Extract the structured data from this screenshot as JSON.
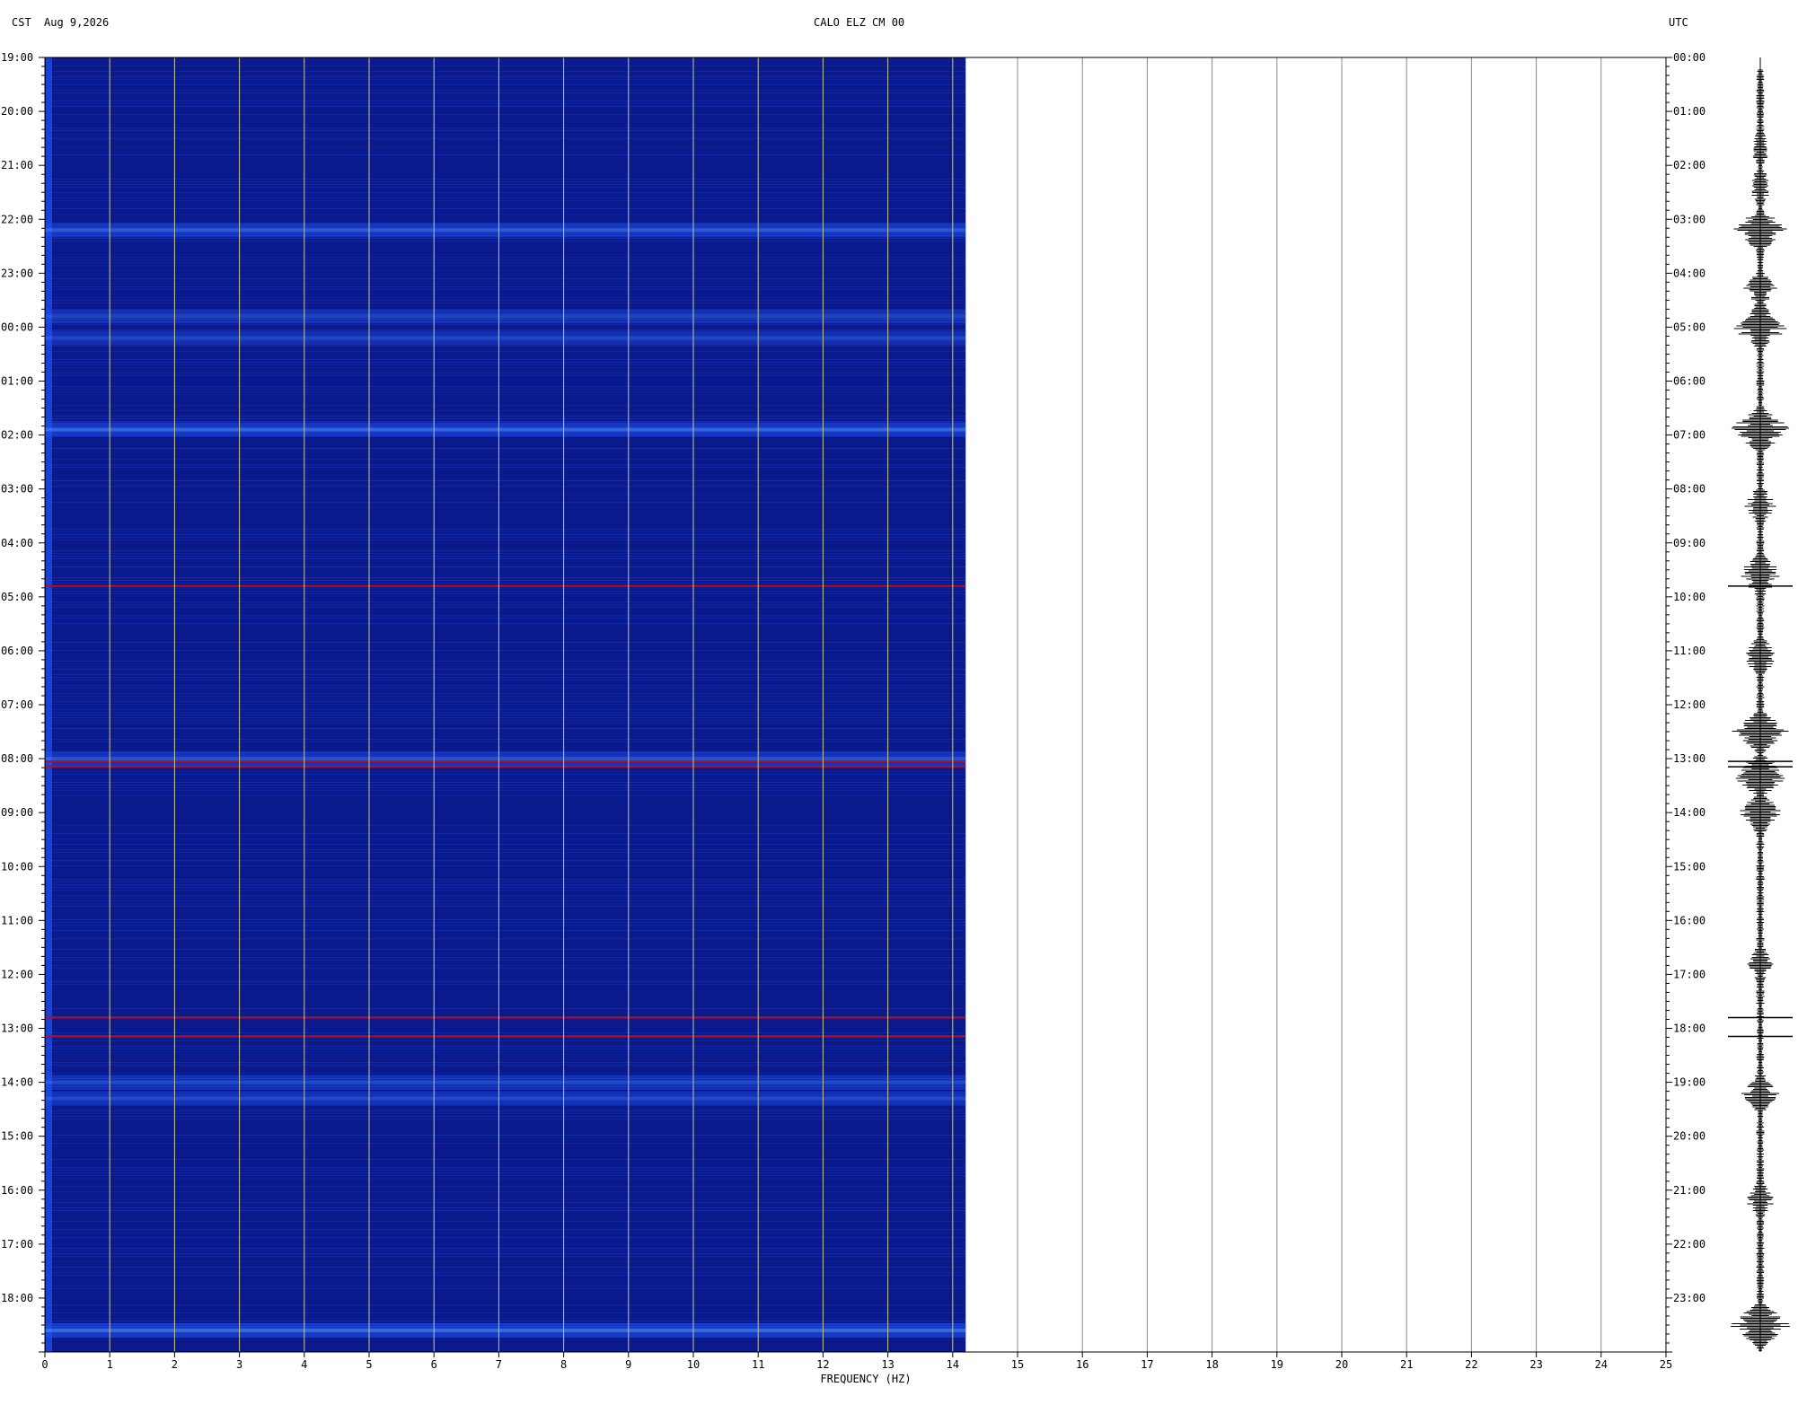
{
  "header": {
    "left_tz": "CST",
    "date": "Aug 9,2026",
    "station": "CALO ELZ CM 00",
    "right_tz": "UTC"
  },
  "chart_data": {
    "type": "heatmap",
    "title": "CALO ELZ CM 00",
    "xlabel": "FREQUENCY (HZ)",
    "x_ticks": [
      "0",
      "1",
      "2",
      "3",
      "4",
      "5",
      "6",
      "7",
      "8",
      "9",
      "10",
      "11",
      "12",
      "13",
      "14",
      "15",
      "16",
      "17",
      "18",
      "19",
      "20",
      "21",
      "22",
      "23",
      "24",
      "25"
    ],
    "xlim": [
      0,
      25
    ],
    "data_xlim": [
      0,
      14.2
    ],
    "left_time_labels": [
      "19:00",
      "20:00",
      "21:00",
      "22:00",
      "23:00",
      "00:00",
      "01:00",
      "02:00",
      "03:00",
      "04:00",
      "05:00",
      "06:00",
      "07:00",
      "08:00",
      "09:00",
      "10:00",
      "11:00",
      "12:00",
      "13:00",
      "14:00",
      "15:00",
      "16:00",
      "17:00",
      "18:00"
    ],
    "right_time_labels": [
      "00:00",
      "01:00",
      "02:00",
      "03:00",
      "04:00",
      "05:00",
      "06:00",
      "07:00",
      "08:00",
      "09:00",
      "10:00",
      "11:00",
      "12:00",
      "13:00",
      "14:00",
      "15:00",
      "16:00",
      "17:00",
      "18:00",
      "19:00",
      "20:00",
      "21:00",
      "22:00",
      "23:00"
    ],
    "time_range_hours": 24,
    "colors": {
      "background": "#0a1a8c",
      "band": "#1f4ef0",
      "strong": "#6fd0ff",
      "spike": "#b01020",
      "grid": "#c8c890"
    },
    "bright_bands_hours": [
      {
        "t": 3.2,
        "level": 0.7
      },
      {
        "t": 4.8,
        "level": 0.4
      },
      {
        "t": 5.2,
        "level": 0.45
      },
      {
        "t": 6.9,
        "level": 0.85
      },
      {
        "t": 13.0,
        "level": 0.6
      },
      {
        "t": 19.0,
        "level": 0.5
      },
      {
        "t": 19.3,
        "level": 0.45
      },
      {
        "t": 23.6,
        "level": 0.9
      }
    ],
    "spike_lines_hours": [
      9.8,
      13.05,
      13.15,
      17.8,
      18.15
    ],
    "trace_envelope": [
      {
        "t": 0.3,
        "a": 0.05
      },
      {
        "t": 1.7,
        "a": 0.35
      },
      {
        "t": 2.4,
        "a": 0.4
      },
      {
        "t": 3.2,
        "a": 0.85
      },
      {
        "t": 4.3,
        "a": 0.55
      },
      {
        "t": 5.0,
        "a": 0.9
      },
      {
        "t": 6.9,
        "a": 1.0
      },
      {
        "t": 8.3,
        "a": 0.5
      },
      {
        "t": 9.6,
        "a": 0.75
      },
      {
        "t": 11.1,
        "a": 0.6
      },
      {
        "t": 12.5,
        "a": 0.85
      },
      {
        "t": 13.3,
        "a": 0.95
      },
      {
        "t": 14.0,
        "a": 0.7
      },
      {
        "t": 16.8,
        "a": 0.4
      },
      {
        "t": 19.2,
        "a": 0.6
      },
      {
        "t": 21.2,
        "a": 0.45
      },
      {
        "t": 23.5,
        "a": 1.0
      }
    ]
  }
}
